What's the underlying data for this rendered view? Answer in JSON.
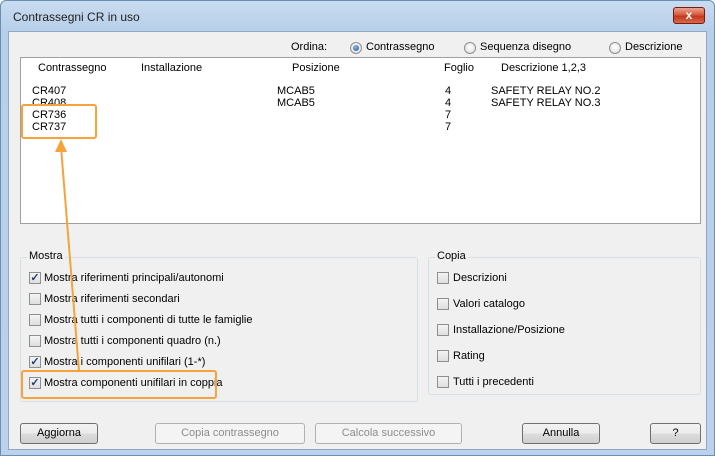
{
  "window": {
    "title": "Contrassegni CR in uso",
    "close_glyph": "x"
  },
  "sort": {
    "label": "Ordina:",
    "options": [
      {
        "label": "Contrassegno",
        "selected": true
      },
      {
        "label": "Sequenza disegno",
        "selected": false
      },
      {
        "label": "Descrizione",
        "selected": false
      }
    ]
  },
  "list": {
    "columns": [
      "Contrassegno",
      "Installazione",
      "Posizione",
      "Foglio",
      "Descrizione 1,2,3"
    ],
    "rows": [
      [
        "CR407",
        "",
        "MCAB5",
        "4",
        "SAFETY RELAY NO.2"
      ],
      [
        "CR408",
        "",
        "MCAB5",
        "4",
        "SAFETY RELAY NO.3"
      ],
      [
        "CR736",
        "",
        "",
        "7",
        ""
      ],
      [
        "CR737",
        "",
        "",
        "7",
        ""
      ]
    ]
  },
  "mostra": {
    "title": "Mostra",
    "items": [
      {
        "label": "Mostra riferimenti principali/autonomi",
        "checked": true
      },
      {
        "label": "Mostra riferimenti secondari",
        "checked": false
      },
      {
        "label": "Mostra tutti i componenti di tutte le famiglie",
        "checked": false
      },
      {
        "label": "Mostra tutti i componenti quadro (n.)",
        "checked": false
      },
      {
        "label": "Mostra i componenti unifilari (1-*)",
        "checked": true
      },
      {
        "label": "Mostra componenti unifilari in coppia",
        "checked": true
      }
    ]
  },
  "copia": {
    "title": "Copia",
    "items": [
      {
        "label": "Descrizioni",
        "checked": false
      },
      {
        "label": "Valori catalogo",
        "checked": false
      },
      {
        "label": "Installazione/Posizione",
        "checked": false
      },
      {
        "label": "Rating",
        "checked": false
      },
      {
        "label": "Tutti i precedenti",
        "checked": false
      }
    ]
  },
  "buttons": {
    "aggiorna": "Aggiorna",
    "copia_contrassegno": "Copia contrassegno",
    "calcola_successivo": "Calcola successivo",
    "annulla": "Annulla",
    "help": "?"
  },
  "colors": {
    "highlight": "#f5a33a"
  }
}
